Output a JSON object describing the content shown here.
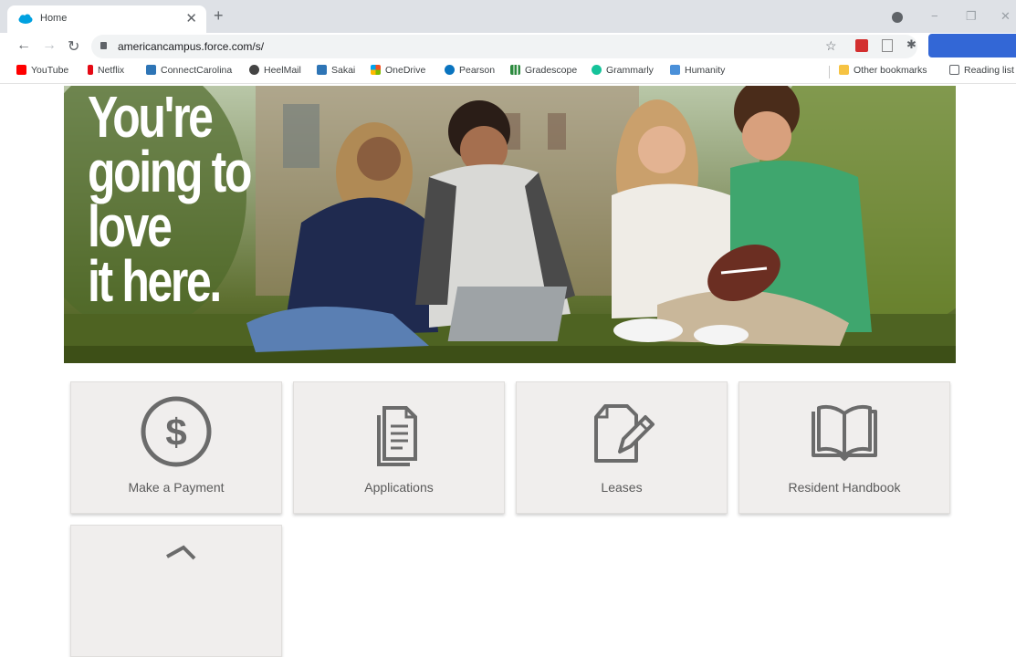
{
  "browser": {
    "tab_title": "Home",
    "url": "americancampus.force.com/s/",
    "bookmarks": [
      {
        "label": "YouTube",
        "icon": "youtube-icon",
        "color": "#ff0000"
      },
      {
        "label": "Netflix",
        "icon": "netflix-icon",
        "color": "#e50914"
      },
      {
        "label": "ConnectCarolina",
        "icon": "building-icon",
        "color": "#2e75b6"
      },
      {
        "label": "HeelMail",
        "icon": "globe-icon",
        "color": "#444444"
      },
      {
        "label": "Sakai",
        "icon": "building-icon",
        "color": "#2e75b6"
      },
      {
        "label": "OneDrive",
        "icon": "windows-icon",
        "color": "#f25022"
      },
      {
        "label": "Pearson",
        "icon": "pearson-icon",
        "color": "#0a74bf"
      },
      {
        "label": "Gradescope",
        "icon": "bars-icon",
        "color": "#2b8a3e"
      },
      {
        "label": "Grammarly",
        "icon": "grammarly-icon",
        "color": "#15c39a"
      },
      {
        "label": "Humanity",
        "icon": "person-icon",
        "color": "#4a90d9"
      }
    ],
    "other_bookmarks": "Other bookmarks",
    "reading_list": "Reading list"
  },
  "hero": {
    "heading_lines": [
      "You're",
      "going to",
      "love",
      "it here."
    ]
  },
  "tiles": [
    {
      "label": "Make a Payment",
      "icon": "dollar-circle-icon"
    },
    {
      "label": "Applications",
      "icon": "documents-icon"
    },
    {
      "label": "Leases",
      "icon": "lease-pencil-icon"
    },
    {
      "label": "Resident Handbook",
      "icon": "book-icon"
    }
  ]
}
